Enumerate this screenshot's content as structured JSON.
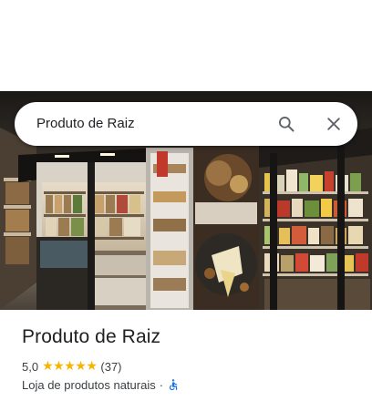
{
  "search": {
    "query": "Produto de Raiz"
  },
  "place": {
    "title": "Produto de Raiz",
    "rating": "5,0",
    "stars": [
      "★",
      "★",
      "★",
      "★",
      "★"
    ],
    "reviews": "(37)",
    "category": "Loja de produtos naturais",
    "separator": "·"
  },
  "icons": {
    "search": "search-icon",
    "close": "close-icon",
    "accessibility": "wheelchair-accessible-icon"
  },
  "colors": {
    "star": "#f4b400",
    "accessibility": "#1a73e8",
    "icon_gray": "#5f6368"
  }
}
